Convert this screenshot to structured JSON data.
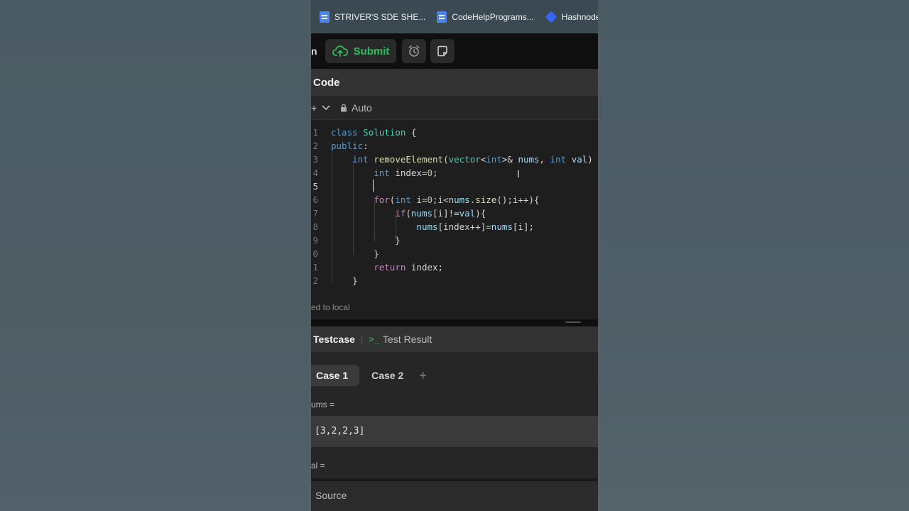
{
  "bookmarks": [
    {
      "label": "STRIVER'S SDE SHE...",
      "icon": "doc-icon"
    },
    {
      "label": "CodeHelpPrograms...",
      "icon": "doc-icon"
    },
    {
      "label": "Hashnode",
      "icon": "hashnode-icon"
    }
  ],
  "toolbar": {
    "edge_text": "n",
    "submit_label": "Submit"
  },
  "code_panel": {
    "title": "Code",
    "lang_plus": "+",
    "mode": "Auto",
    "saved_text": "ed to local"
  },
  "code_lines": {
    "n1": "1",
    "n2": "2",
    "n3": "3",
    "n4": "4",
    "n5": "5",
    "n6": "6",
    "n7": "7",
    "n8": "8",
    "n9": "9",
    "n10": "0",
    "n11": "1",
    "n12": "2"
  },
  "testcase": {
    "tab_active": "Testcase",
    "tab_result": "Test Result",
    "term_glyph": ">_",
    "cases": [
      "Case 1",
      "Case 2"
    ],
    "add_glyph": "+",
    "var1_label": "ums =",
    "var1_value": "[3,2,2,3]",
    "var2_label": "al =",
    "source_label": "Source"
  }
}
